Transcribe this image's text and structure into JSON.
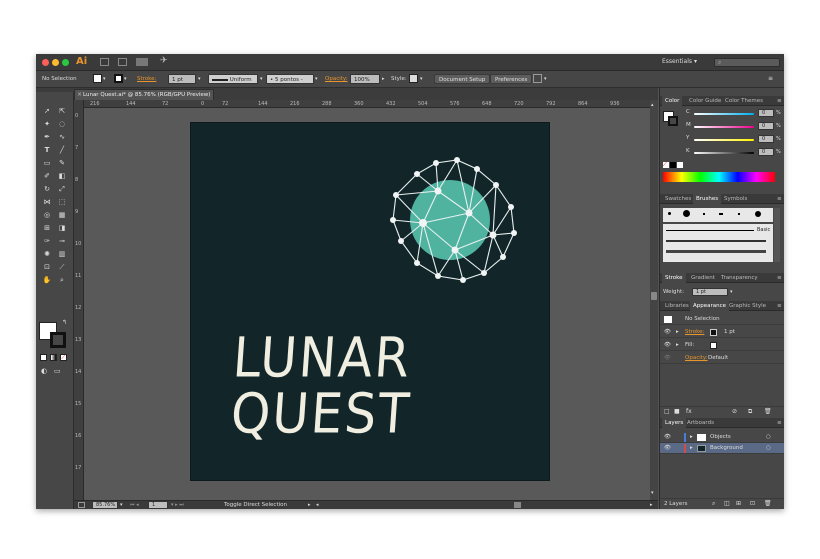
{
  "app": {
    "logo": "Ai",
    "workspace": "Essentials",
    "workspace_arrow": "▾"
  },
  "control": {
    "selection": "No Selection",
    "stroke_label": "Stroke:",
    "stroke_value": "1 pt",
    "uniform": "Uniform",
    "brush": "5 pontos -",
    "opacity_label": "Opacity:",
    "opacity_value": "100%",
    "style_label": "Style:",
    "document_setup": "Document Setup",
    "preferences": "Preferences"
  },
  "document": {
    "tab_title": "Lunar Quest.ai* @ 85.76% (RGB/GPU Preview)"
  },
  "ruler": {
    "h": [
      "216",
      "144",
      "72",
      "0",
      "72",
      "144",
      "216",
      "288",
      "360",
      "432",
      "504",
      "576",
      "648",
      "720",
      "792",
      "864",
      "936"
    ],
    "v": [
      "0",
      "7",
      "8",
      "9",
      "10",
      "11",
      "12",
      "13",
      "14",
      "15",
      "16",
      "17"
    ]
  },
  "artwork": {
    "line1": "LUNAR",
    "line2": "QUEST",
    "bg_color": "#12262a",
    "moon_color": "#4fb3a0",
    "text_color": "#efeee0"
  },
  "status": {
    "zoom": "85.76%",
    "page": "1",
    "toggle": "Toggle Direct Selection"
  },
  "color_panel": {
    "tabs": [
      "Color",
      "Color Guide",
      "Color Themes"
    ],
    "channels": [
      {
        "label": "C",
        "value": "0"
      },
      {
        "label": "M",
        "value": "0"
      },
      {
        "label": "Y",
        "value": "0"
      },
      {
        "label": "K",
        "value": "0"
      }
    ],
    "unit": "%"
  },
  "swatches_panel": {
    "tabs": [
      "Swatches",
      "Brushes",
      "Symbols"
    ],
    "basic": "Basic"
  },
  "stroke_panel": {
    "tabs": [
      "Stroke",
      "Gradient",
      "Transparency"
    ],
    "weight_label": "Weight:",
    "weight_value": "1 pt"
  },
  "appearance_panel": {
    "tabs": [
      "Libraries",
      "Appearance",
      "Graphic Style"
    ],
    "no_selection": "No Selection",
    "stroke_label": "Stroke:",
    "stroke_value": "1 pt",
    "fill_label": "Fill:",
    "opacity_label": "Opacity:",
    "opacity_value": "Default"
  },
  "layers_panel": {
    "tabs": [
      "Layers",
      "Artboards"
    ],
    "layers": [
      {
        "name": "Objects",
        "color": "#4a7bd8"
      },
      {
        "name": "Background",
        "color": "#d84a4a"
      }
    ],
    "count": "2 Layers"
  }
}
